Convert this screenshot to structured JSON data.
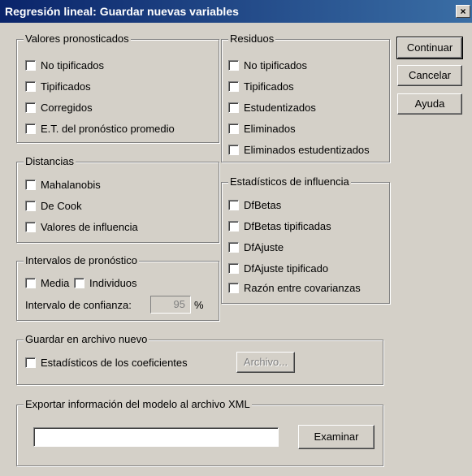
{
  "dialog": {
    "title": "Regresión lineal: Guardar nuevas variables",
    "close_label": "×"
  },
  "buttons": {
    "continue": "Continuar",
    "cancel": "Cancelar",
    "help": "Ayuda"
  },
  "predicted": {
    "title": "Valores pronosticados",
    "items": [
      "No tipificados",
      "Tipificados",
      "Corregidos",
      "E.T. del pronóstico promedio"
    ]
  },
  "residuals": {
    "title": "Residuos",
    "items": [
      "No tipificados",
      "Tipificados",
      "Estudentizados",
      "Eliminados",
      "Eliminados estudentizados"
    ]
  },
  "distances": {
    "title": "Distancias",
    "items": [
      "Mahalanobis",
      "De Cook",
      "Valores de influencia"
    ]
  },
  "influence": {
    "title": "Estadísticos de influencia",
    "items": [
      "DfBetas",
      "DfBetas tipificadas",
      "DfAjuste",
      "DfAjuste tipificado",
      "Razón entre covarianzas"
    ]
  },
  "intervals": {
    "title": "Intervalos de pronóstico",
    "mean": "Media",
    "individual": "Individuos",
    "confidence_label": "Intervalo de confianza:",
    "confidence_value": "95",
    "percent": "%"
  },
  "save_file": {
    "title": "Guardar en archivo nuevo",
    "coefficients": "Estadísticos de los coeficientes",
    "file_button": "Archivo..."
  },
  "export": {
    "title": "Exportar información del modelo al archivo XML",
    "path_value": "",
    "browse_button": "Examinar"
  }
}
